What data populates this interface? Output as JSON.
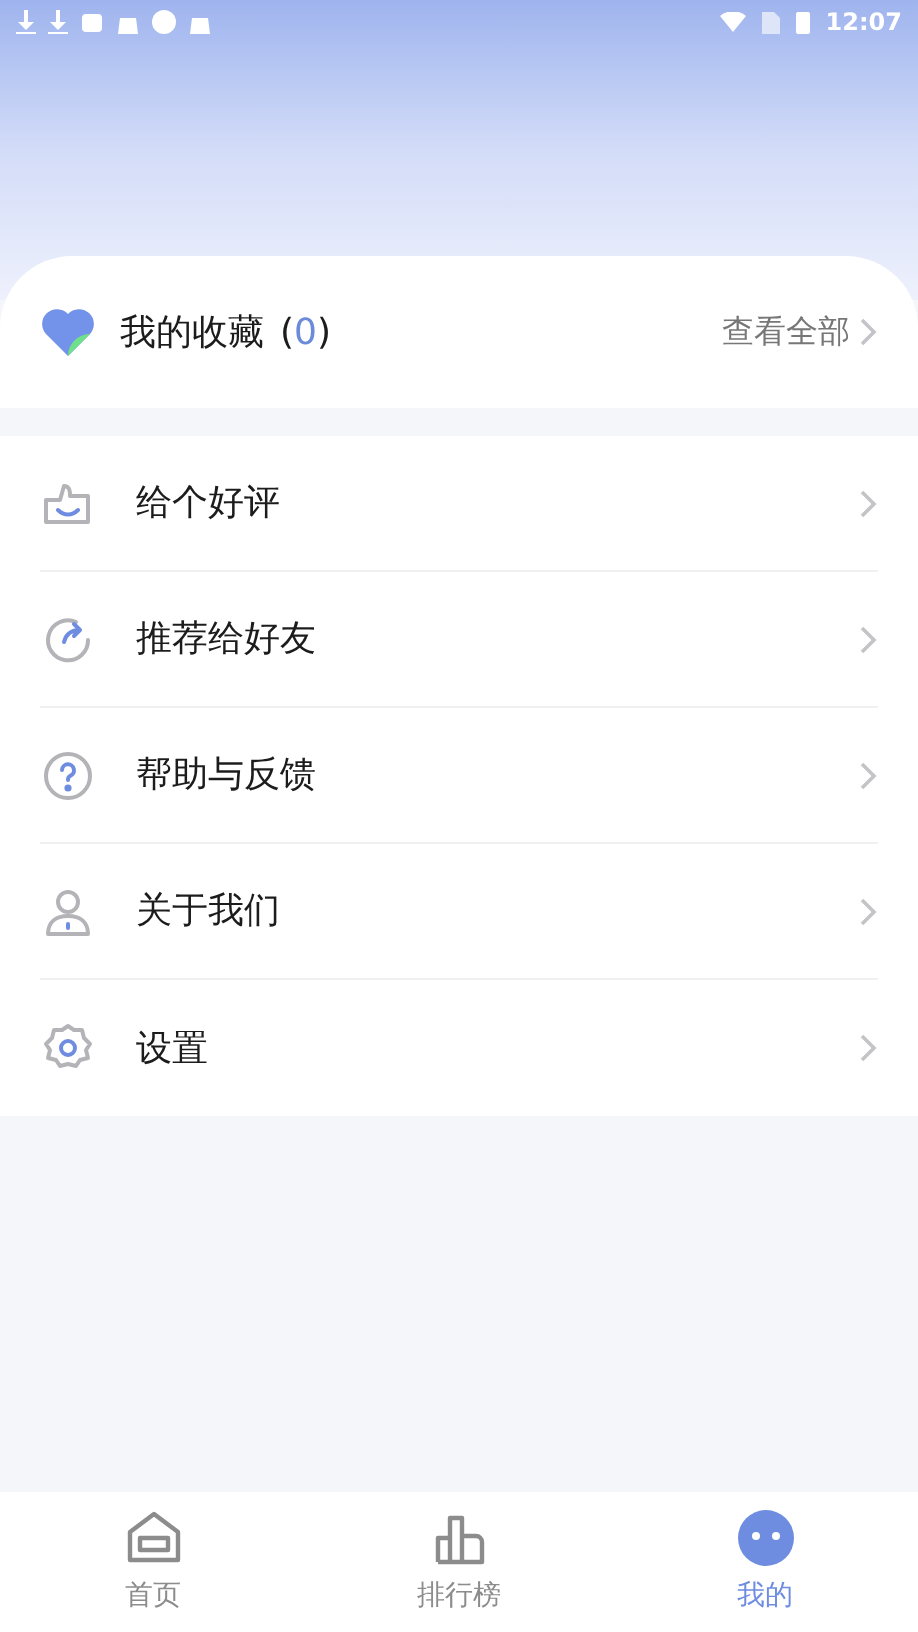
{
  "status_bar": {
    "time": "12:07"
  },
  "favorites": {
    "title": "我的收藏",
    "brackets": [
      "(",
      ")"
    ],
    "count": "0",
    "view_all": "查看全部"
  },
  "menu": [
    {
      "kind": "thumb",
      "label": "给个好评"
    },
    {
      "kind": "share",
      "label": "推荐给好友"
    },
    {
      "kind": "help",
      "label": "帮助与反馈"
    },
    {
      "kind": "about",
      "label": "关于我们"
    },
    {
      "kind": "settings",
      "label": "设置"
    }
  ],
  "tabs": [
    {
      "kind": "home",
      "label": "首页",
      "selected": false
    },
    {
      "kind": "rank",
      "label": "排行榜",
      "selected": false
    },
    {
      "kind": "mine",
      "label": "我的",
      "selected": true
    }
  ]
}
